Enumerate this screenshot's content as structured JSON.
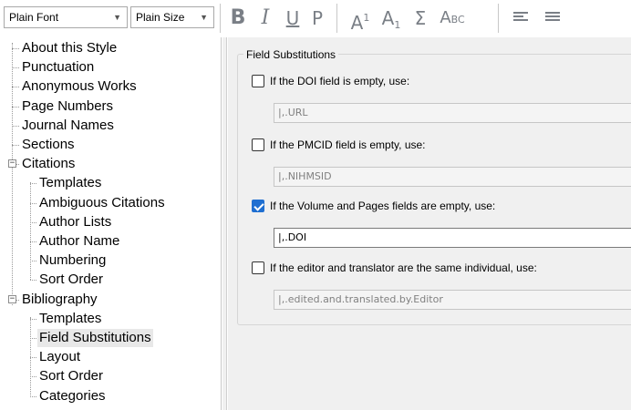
{
  "toolbar": {
    "font_select": "Plain Font",
    "size_select": "Plain Size",
    "bold": "B",
    "italic": "I",
    "underline": "U",
    "plain": "P",
    "superscript_base": "A",
    "superscript_mark": "1",
    "subscript_base": "A",
    "subscript_mark": "1",
    "symbol": "Σ",
    "small_caps_big": "A",
    "small_caps_small": "BC",
    "align_icon": "align-left-icon",
    "justify_icon": "justify-icon",
    "icon_color": "#7a7f86"
  },
  "tree": {
    "items": [
      {
        "label": "About this Style"
      },
      {
        "label": "Punctuation"
      },
      {
        "label": "Anonymous Works"
      },
      {
        "label": "Page Numbers"
      },
      {
        "label": "Journal Names"
      },
      {
        "label": "Sections"
      },
      {
        "label": "Citations",
        "expander": "−"
      },
      {
        "label": "Templates"
      },
      {
        "label": "Ambiguous Citations"
      },
      {
        "label": "Author Lists"
      },
      {
        "label": "Author Name"
      },
      {
        "label": "Numbering"
      },
      {
        "label": "Sort Order"
      },
      {
        "label": "Bibliography",
        "expander": "−"
      },
      {
        "label": "Templates"
      },
      {
        "label": "Field Substitutions",
        "selected": true
      },
      {
        "label": "Layout"
      },
      {
        "label": "Sort Order"
      },
      {
        "label": "Categories"
      }
    ]
  },
  "main": {
    "group_title": "Field Substitutions",
    "substitutions": [
      {
        "label": "If the DOI field is empty, use:",
        "checked": false,
        "value": "|,.URL"
      },
      {
        "label": "If the PMCID field is empty, use:",
        "checked": false,
        "value": "|,.NIHMSID"
      },
      {
        "label": "If the Volume and Pages fields are empty, use:",
        "checked": true,
        "value": "|,.DOI"
      },
      {
        "label": "If the editor and translator are the same individual, use:",
        "checked": false,
        "value": "|,.edited.and.translated.by.Editor"
      }
    ],
    "check_color": "#1f6fd1"
  }
}
